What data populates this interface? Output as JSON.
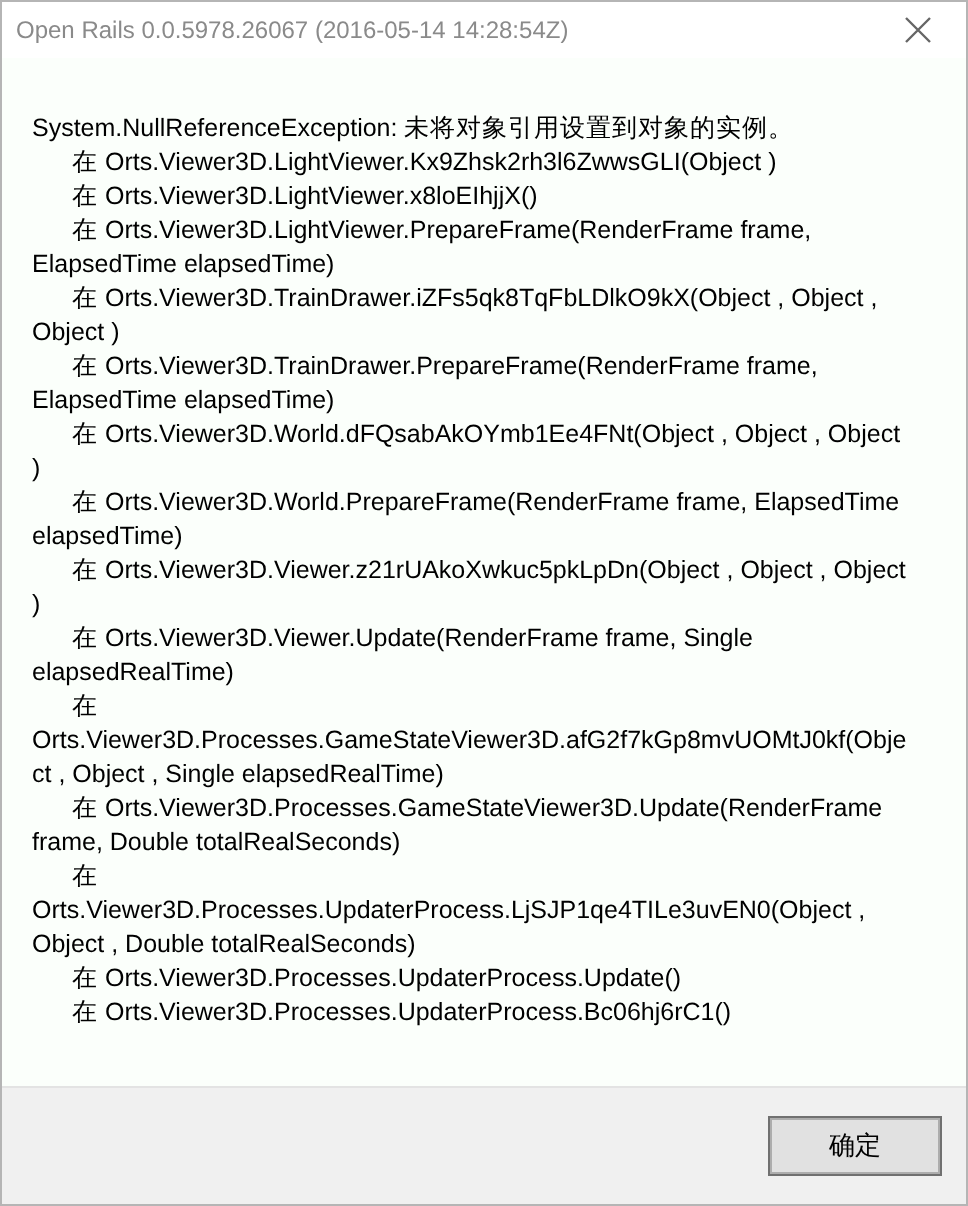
{
  "window": {
    "title": "Open Rails 0.0.5978.26067 (2016-05-14 14:28:54Z)"
  },
  "message": {
    "heading": "System.NullReferenceException: 未将对象引用设置到对象的实例。",
    "frames": [
      "在 Orts.Viewer3D.LightViewer.Kx9Zhsk2rh3l6ZwwsGLI(Object )",
      "在 Orts.Viewer3D.LightViewer.x8loEIhjjX()",
      "在 Orts.Viewer3D.LightViewer.PrepareFrame(RenderFrame frame, ElapsedTime elapsedTime)",
      "在 Orts.Viewer3D.TrainDrawer.iZFs5qk8TqFbLDlkO9kX(Object , Object , Object )",
      "在 Orts.Viewer3D.TrainDrawer.PrepareFrame(RenderFrame frame, ElapsedTime elapsedTime)",
      "在 Orts.Viewer3D.World.dFQsabAkOYmb1Ee4FNt(Object , Object , Object )",
      "在 Orts.Viewer3D.World.PrepareFrame(RenderFrame frame, ElapsedTime elapsedTime)",
      "在 Orts.Viewer3D.Viewer.z21rUAkoXwkuc5pkLpDn(Object , Object , Object )",
      "在 Orts.Viewer3D.Viewer.Update(RenderFrame frame, Single elapsedRealTime)",
      "在 Orts.Viewer3D.Processes.GameStateViewer3D.afG2f7kGp8mvUOMtJ0kf(Object , Object , Single elapsedRealTime)",
      "在 Orts.Viewer3D.Processes.GameStateViewer3D.Update(RenderFrame frame, Double totalRealSeconds)",
      "在 Orts.Viewer3D.Processes.UpdaterProcess.LjSJP1qe4TILe3uvEN0(Object , Object , Double totalRealSeconds)",
      "在 Orts.Viewer3D.Processes.UpdaterProcess.Update()",
      "在 Orts.Viewer3D.Processes.UpdaterProcess.Bc06hj6rC1()"
    ]
  },
  "buttons": [
    {
      "label": "确定"
    }
  ]
}
